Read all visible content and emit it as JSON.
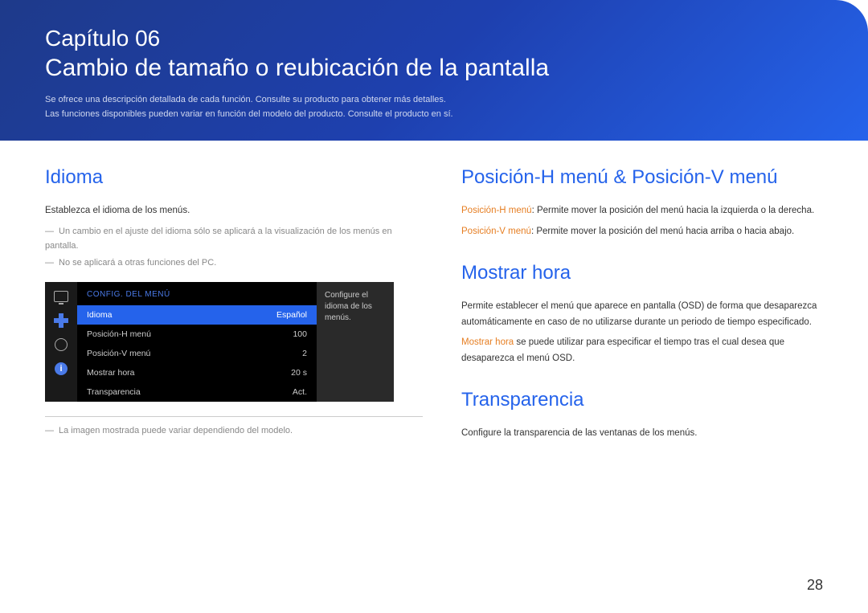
{
  "banner": {
    "chapter": "Capítulo 06",
    "title": "Cambio de tamaño o reubicación de la pantalla",
    "desc1": "Se ofrece una descripción detallada de cada función. Consulte su producto para obtener más detalles.",
    "desc2": "Las funciones disponibles pueden variar en función del modelo del producto. Consulte el producto en sí."
  },
  "left": {
    "idioma_title": "Idioma",
    "idioma_body": "Establezca el idioma de los menús.",
    "idioma_note1": "Un cambio en el ajuste del idioma sólo se aplicará a la visualización de los menús en pantalla.",
    "idioma_note2": "No se aplicará a otras funciones del PC.",
    "divider_note": "La imagen mostrada puede variar dependiendo del modelo."
  },
  "osd": {
    "header": "CONFIG. DEL MENÚ",
    "tooltip": "Configure el idioma de los menús.",
    "info_glyph": "i",
    "rows": [
      {
        "label": "Idioma",
        "value": "Español",
        "selected": true
      },
      {
        "label": "Posición-H menú",
        "value": "100",
        "selected": false
      },
      {
        "label": "Posición-V menú",
        "value": "2",
        "selected": false
      },
      {
        "label": "Mostrar hora",
        "value": "20 s",
        "selected": false
      },
      {
        "label": "Transparencia",
        "value": "Act.",
        "selected": false
      }
    ]
  },
  "right": {
    "pos_title": "Posición-H menú & Posición-V menú",
    "pos_h_label": "Posición-H menú",
    "pos_h_text": ": Permite mover la posición del menú hacia la izquierda o la derecha.",
    "pos_v_label": "Posición-V menú",
    "pos_v_text": ": Permite mover la posición del menú hacia arriba o hacia abajo.",
    "mostrar_title": "Mostrar hora",
    "mostrar_body1": "Permite establecer el menú que aparece en pantalla (OSD) de forma que desaparezca automáticamente en caso de no utilizarse durante un periodo de tiempo especificado.",
    "mostrar_label": "Mostrar hora",
    "mostrar_body2": " se puede utilizar para especificar el tiempo tras el cual desea que desaparezca el menú OSD.",
    "trans_title": "Transparencia",
    "trans_body": "Configure la transparencia de las ventanas de los menús."
  },
  "page_number": "28"
}
